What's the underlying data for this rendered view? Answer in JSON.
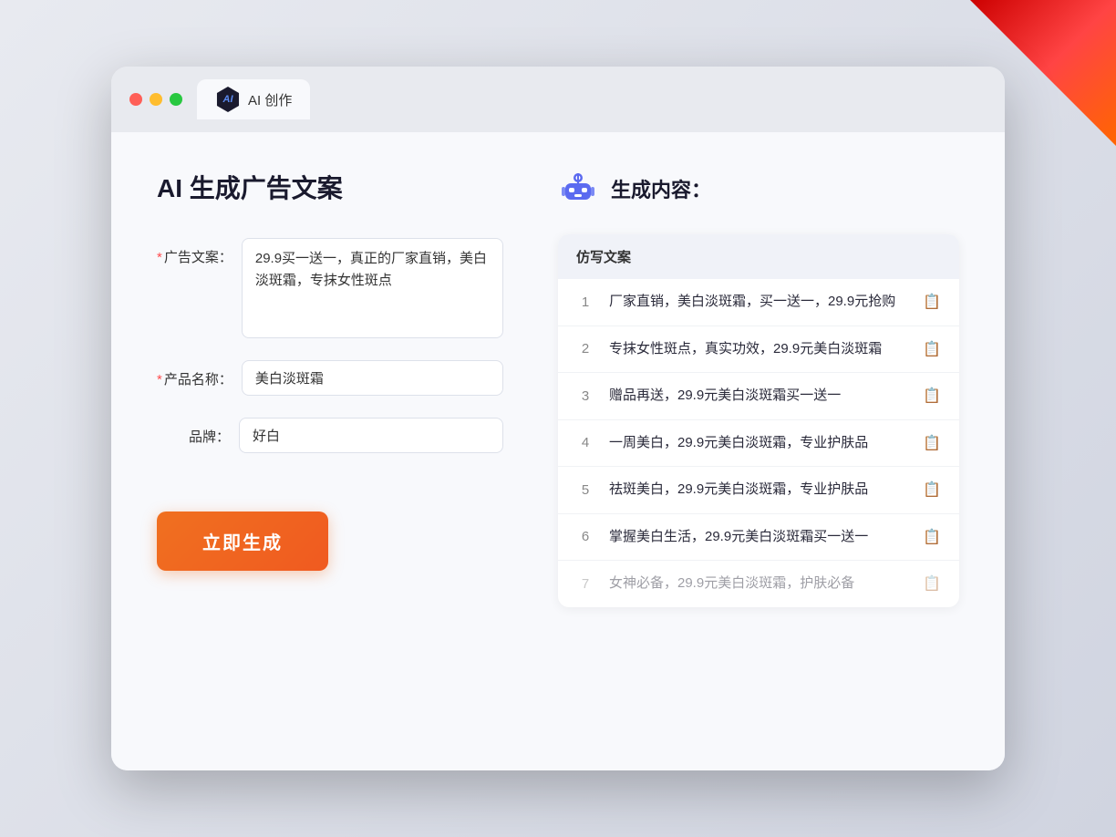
{
  "window": {
    "tab_label": "AI 创作"
  },
  "page": {
    "title": "AI 生成广告文案"
  },
  "form": {
    "ad_copy_label": "广告文案：",
    "ad_copy_value": "29.9买一送一，真正的厂家直销，美白淡斑霜，专抹女性斑点",
    "product_name_label": "产品名称：",
    "product_name_value": "美白淡斑霜",
    "brand_label": "品牌：",
    "brand_value": "好白",
    "generate_button": "立即生成"
  },
  "result": {
    "header_label": "生成内容：",
    "table_column": "仿写文案",
    "rows": [
      {
        "num": 1,
        "text": "厂家直销，美白淡斑霜，买一送一，29.9元抢购",
        "faded": false
      },
      {
        "num": 2,
        "text": "专抹女性斑点，真实功效，29.9元美白淡斑霜",
        "faded": false
      },
      {
        "num": 3,
        "text": "赠品再送，29.9元美白淡斑霜买一送一",
        "faded": false
      },
      {
        "num": 4,
        "text": "一周美白，29.9元美白淡斑霜，专业护肤品",
        "faded": false
      },
      {
        "num": 5,
        "text": "祛斑美白，29.9元美白淡斑霜，专业护肤品",
        "faded": false
      },
      {
        "num": 6,
        "text": "掌握美白生活，29.9元美白淡斑霜买一送一",
        "faded": false
      },
      {
        "num": 7,
        "text": "女神必备，29.9元美白淡斑霜，护肤必备",
        "faded": true
      }
    ]
  }
}
